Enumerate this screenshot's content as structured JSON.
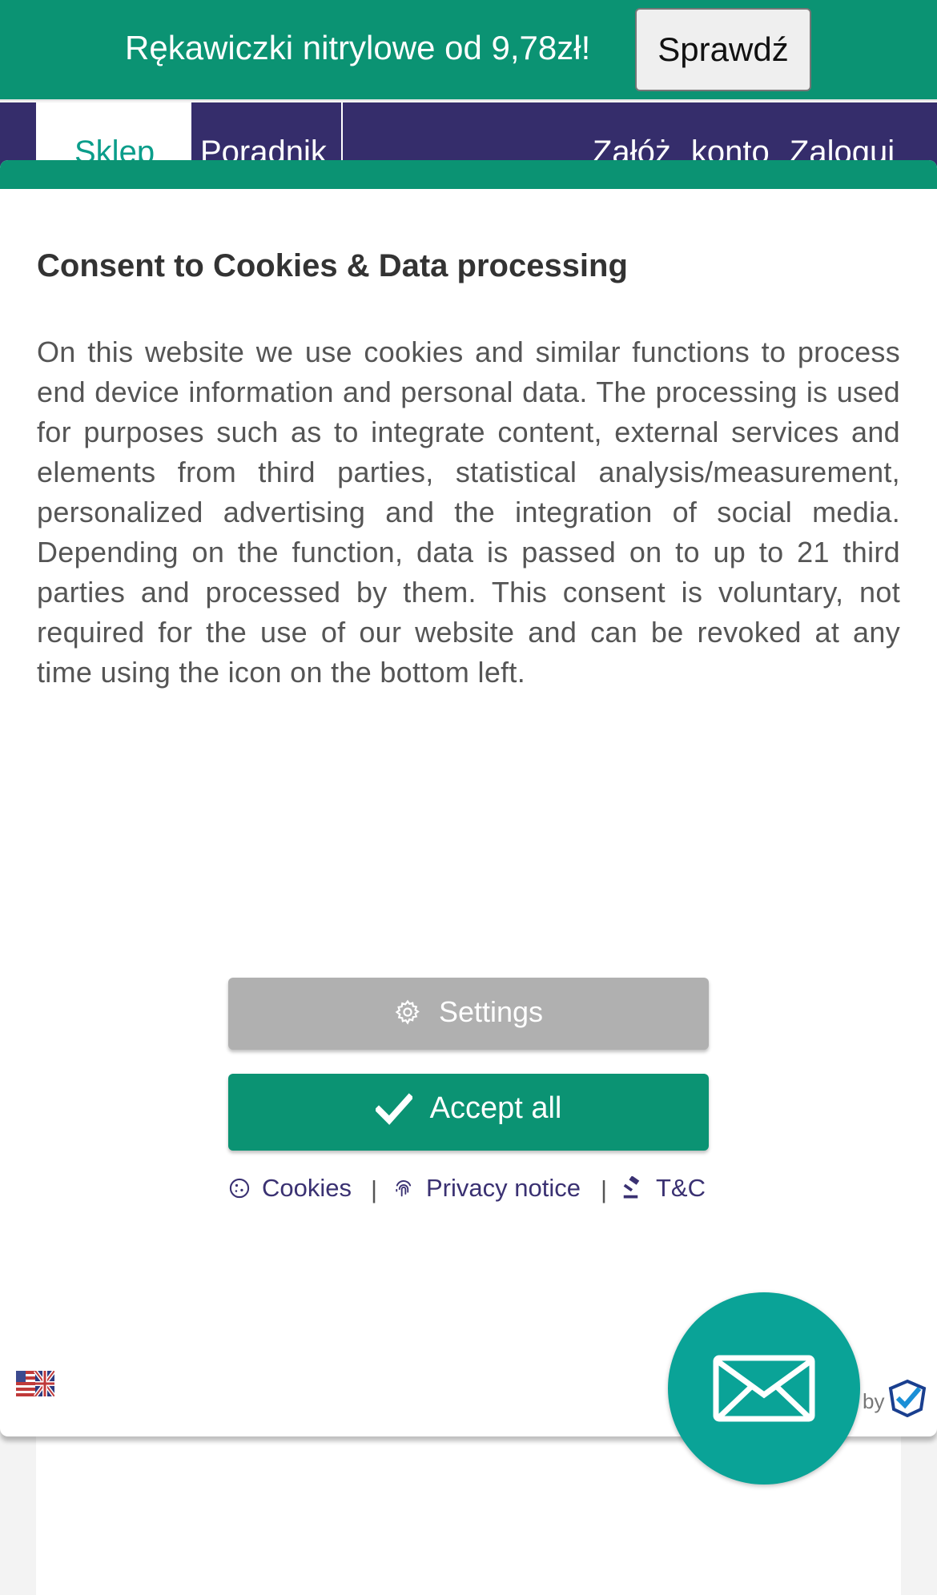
{
  "promo": {
    "text": "Rękawiczki nitrylowe od 9,78zł!",
    "button_label": "Sprawdź"
  },
  "nav": {
    "tabs": [
      {
        "label": "Sklep"
      },
      {
        "label": "Poradnik"
      }
    ],
    "right_links": "Załóż konto  Zaloguj"
  },
  "consent": {
    "title": "Consent to Cookies & Data processing",
    "body": "On this website we use cookies and similar functions to process end device information and personal data. The processing is used for purposes such as to integrate content, external services and elements from third parties, statistical analysis/measurement, personalized advertising and the integration of social media. Depending on the function, data is passed on to up to 21 third parties and processed by them. This consent is voluntary, not required for the use of our website and can be revoked at any time using the icon on the bottom left.",
    "settings_label": "Settings",
    "accept_label": "Accept all",
    "links": {
      "cookies": "Cookies",
      "privacy": "Privacy notice",
      "tc": "T&C",
      "separator": "|"
    },
    "by_label": "by"
  },
  "colors": {
    "brand_green": "#0b9373",
    "nav_purple": "#352d6b",
    "fab_teal": "#0aa397",
    "settings_grey": "#b0b0b0"
  },
  "icons": [
    "gear-icon",
    "checkmark-icon",
    "cookie-icon",
    "fingerprint-icon",
    "gavel-icon",
    "flag-icon",
    "verified-logo-icon",
    "mail-icon"
  ]
}
